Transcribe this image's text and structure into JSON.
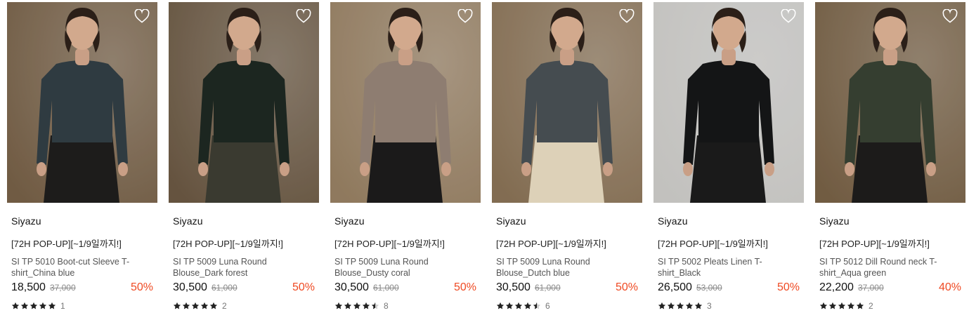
{
  "products": [
    {
      "brand": "Siyazu",
      "promo": "[72H POP-UP][~1/9일까지!]",
      "name": "SI TP 5010 Boot-cut Sleeve T-shirt_China blue",
      "price": "18,500",
      "original_price": "37,000",
      "discount": "50%",
      "rating": 5,
      "reviews": "1",
      "top_color": "#2f3b41",
      "bottom_color": "#1d1c1b",
      "bg_color": "#7a6349"
    },
    {
      "brand": "Siyazu",
      "promo": "[72H POP-UP][~1/9일까지!]",
      "name": "SI TP 5009 Luna Round Blouse_Dark forest",
      "price": "30,500",
      "original_price": "61,000",
      "discount": "50%",
      "rating": 5,
      "reviews": "2",
      "top_color": "#1c2620",
      "bottom_color": "#3a3a30",
      "bg_color": "#6e5b45"
    },
    {
      "brand": "Siyazu",
      "promo": "[72H POP-UP][~1/9일까지!]",
      "name": "SI TP 5009 Luna Round Blouse_Dusty coral",
      "price": "30,500",
      "original_price": "61,000",
      "discount": "50%",
      "rating": 4.5,
      "reviews": "8",
      "top_color": "#8e7d71",
      "bottom_color": "#1b1a1a",
      "bg_color": "#9c8466"
    },
    {
      "brand": "Siyazu",
      "promo": "[72H POP-UP][~1/9일까지!]",
      "name": "SI TP 5009 Luna Round Blouse_Dutch blue",
      "price": "30,500",
      "original_price": "61,000",
      "discount": "50%",
      "rating": 4.5,
      "reviews": "6",
      "top_color": "#454c50",
      "bottom_color": "#ddd1b8",
      "bg_color": "#8e7659"
    },
    {
      "brand": "Siyazu",
      "promo": "[72H POP-UP][~1/9일까지!]",
      "name": "SI TP 5002 Pleats Linen T-shirt_Black",
      "price": "26,500",
      "original_price": "53,000",
      "discount": "50%",
      "rating": 5,
      "reviews": "3",
      "top_color": "#141516",
      "bottom_color": "#1a1a1a",
      "bg_color": "#d3d2cf"
    },
    {
      "brand": "Siyazu",
      "promo": "[72H POP-UP][~1/9일까지!]",
      "name": "SI TP 5012 Dill Round neck T-shirt_Aqua green",
      "price": "22,200",
      "original_price": "37,000",
      "discount": "40%",
      "rating": 5,
      "reviews": "2",
      "top_color": "#353e30",
      "bottom_color": "#1c1b1a",
      "bg_color": "#7b6448"
    }
  ],
  "icons": {
    "wishlist": "heart-outline-icon",
    "rating": "star-icon"
  },
  "colors": {
    "discount": "#ef4a23",
    "star": "#222222"
  }
}
